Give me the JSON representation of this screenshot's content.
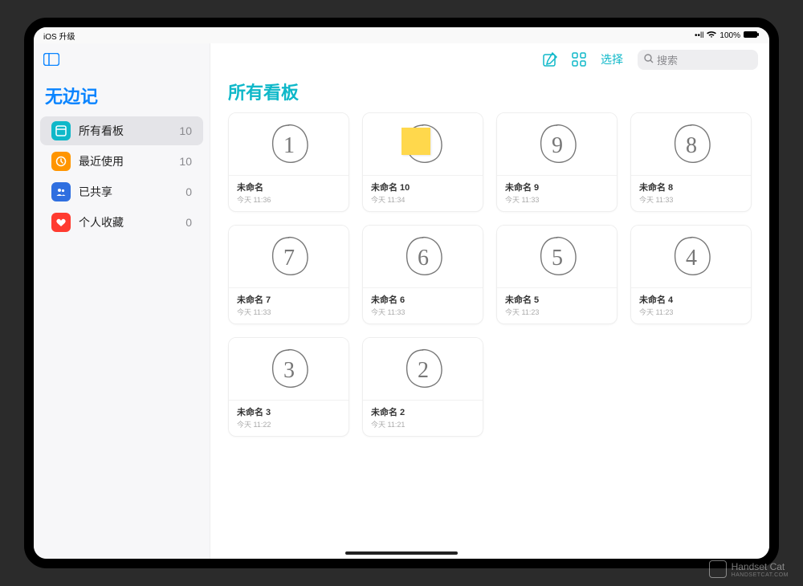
{
  "status": {
    "left": "iOS 升级",
    "signal": "••ll",
    "wifi": "wifi",
    "battery_text": "100%"
  },
  "app_title": "无边记",
  "sidebar": {
    "items": [
      {
        "icon_name": "boards-icon",
        "icon_bg": "#0fb8c9",
        "label": "所有看板",
        "count": "10",
        "selected": true
      },
      {
        "icon_name": "recent-icon",
        "icon_bg": "#ff9500",
        "label": "最近使用",
        "count": "10",
        "selected": false
      },
      {
        "icon_name": "shared-icon",
        "icon_bg": "#2f6fe0",
        "label": "已共享",
        "count": "0",
        "selected": false
      },
      {
        "icon_name": "favorites-icon",
        "icon_bg": "#ff3b30",
        "label": "个人收藏",
        "count": "0",
        "selected": false
      }
    ]
  },
  "toolbar": {
    "compose": "compose",
    "view_toggle": "grid",
    "select_label": "选择",
    "search_placeholder": "搜索"
  },
  "main_title": "所有看板",
  "boards": [
    {
      "name": "未命名",
      "time": "今天 11:36",
      "digit": "1",
      "sticky": false
    },
    {
      "name": "未命名 10",
      "time": "今天 11:34",
      "digit": "0",
      "sticky": true
    },
    {
      "name": "未命名 9",
      "time": "今天 11:33",
      "digit": "9",
      "sticky": false
    },
    {
      "name": "未命名 8",
      "time": "今天 11:33",
      "digit": "8",
      "sticky": false
    },
    {
      "name": "未命名 7",
      "time": "今天 11:33",
      "digit": "7",
      "sticky": false
    },
    {
      "name": "未命名 6",
      "time": "今天 11:33",
      "digit": "6",
      "sticky": false
    },
    {
      "name": "未命名 5",
      "time": "今天 11:23",
      "digit": "5",
      "sticky": false
    },
    {
      "name": "未命名 4",
      "time": "今天 11:23",
      "digit": "4",
      "sticky": false
    },
    {
      "name": "未命名 3",
      "time": "今天 11:22",
      "digit": "3",
      "sticky": false
    },
    {
      "name": "未命名 2",
      "time": "今天 11:21",
      "digit": "2",
      "sticky": false
    }
  ],
  "watermark": {
    "brand": "Handset Cat",
    "url": "HANDSETCAT.COM"
  }
}
